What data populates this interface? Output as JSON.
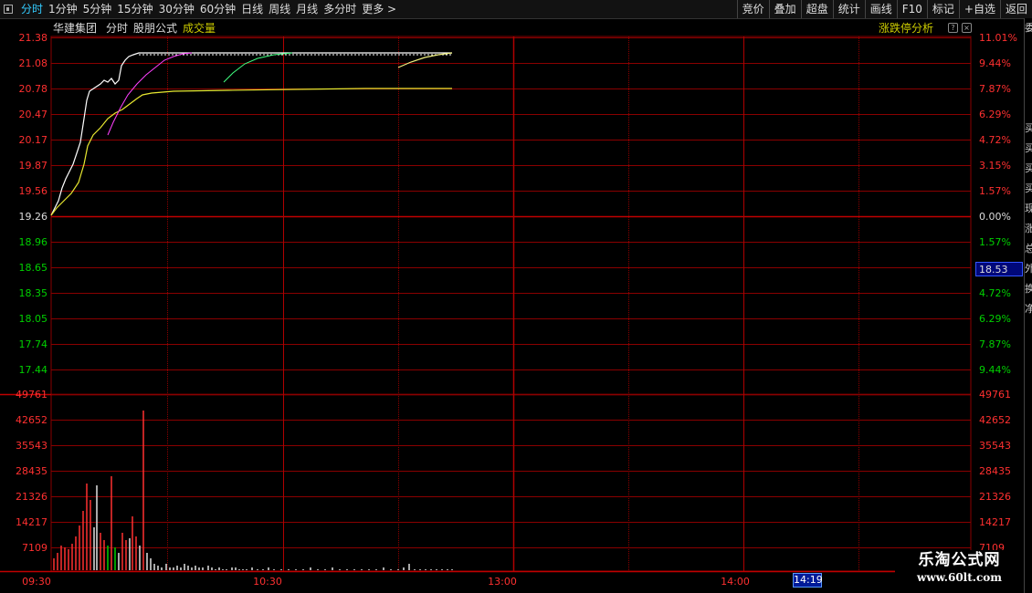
{
  "toolbar": {
    "left_items": [
      "分时",
      "1分钟",
      "5分钟",
      "15分钟",
      "30分钟",
      "60分钟",
      "日线",
      "周线",
      "月线",
      "多分时",
      "更多 >"
    ],
    "active_index": 0,
    "right_items": [
      "竞价",
      "叠加",
      "超盘",
      "统计",
      "画线",
      "F10",
      "标记",
      "+自选",
      "返回"
    ]
  },
  "header": {
    "stock_name": "华建集团",
    "mode": "分时",
    "formula": "股朋公式",
    "volume_label": "成交量",
    "analysis": "涨跌停分析",
    "help_btn": "?",
    "close_btn": "×"
  },
  "price_axis": {
    "left_labels": [
      "21.38",
      "21.08",
      "20.78",
      "20.47",
      "20.17",
      "19.87",
      "19.56",
      "19.26",
      "18.96",
      "18.65",
      "18.35",
      "18.05",
      "17.74",
      "17.44"
    ],
    "right_labels": [
      "11.01%",
      "9.44%",
      "7.87%",
      "6.29%",
      "4.72%",
      "3.15%",
      "1.57%",
      "0.00%",
      "1.57%",
      "4.72%",
      "6.29%",
      "7.87%",
      "9.44%"
    ],
    "prev_close": 19.26,
    "max": 21.38,
    "min": 17.14
  },
  "volume_axis": {
    "labels": [
      "49761",
      "42652",
      "35543",
      "28435",
      "21326",
      "14217",
      "7109"
    ],
    "max": 49761
  },
  "time_axis": {
    "labels": [
      "09:30",
      "10:30",
      "13:00",
      "14:00"
    ]
  },
  "current_price": "18.53",
  "time_cursor": "14:19",
  "right_panel_chars": [
    "委",
    "",
    "",
    "",
    "",
    "买",
    "买",
    "买",
    "买",
    "现",
    "涨",
    "总",
    "外",
    "换",
    "净",
    "",
    "",
    "",
    "",
    "",
    "",
    "",
    "",
    ""
  ],
  "watermark": {
    "title": "乐淘公式网",
    "url": "www.60lt.com"
  },
  "colors": {
    "up": "#ff3030",
    "down": "#00d000",
    "grid": "#8a0000",
    "price_line": "#ffffff",
    "avg_line": "#e8e830",
    "magenta": "#ff40ff",
    "green": "#40ff80"
  }
}
